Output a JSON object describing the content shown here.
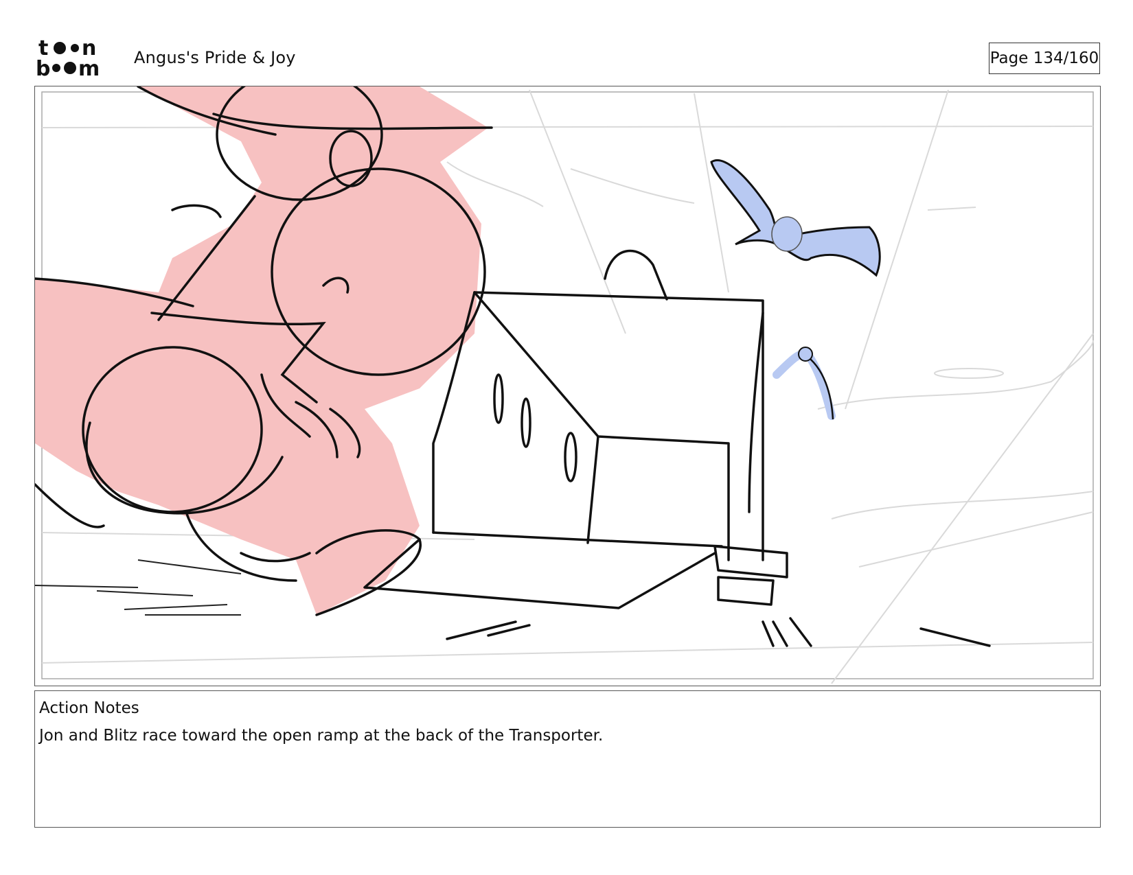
{
  "header": {
    "logo_text": "toon boom",
    "project_title": "Angus's Pride & Joy",
    "page_label": "Page 134/160"
  },
  "panel": {
    "image": "storyboard sketch"
  },
  "notes": {
    "heading": "Action Notes",
    "text": "Jon and Blitz race toward the open ramp at the back of the Transporter."
  },
  "colors": {
    "character_fill": "#f7c1c1",
    "bird_fill": "#b8c9f2",
    "line": "#111111",
    "background_lines": "#d8d8d8"
  }
}
